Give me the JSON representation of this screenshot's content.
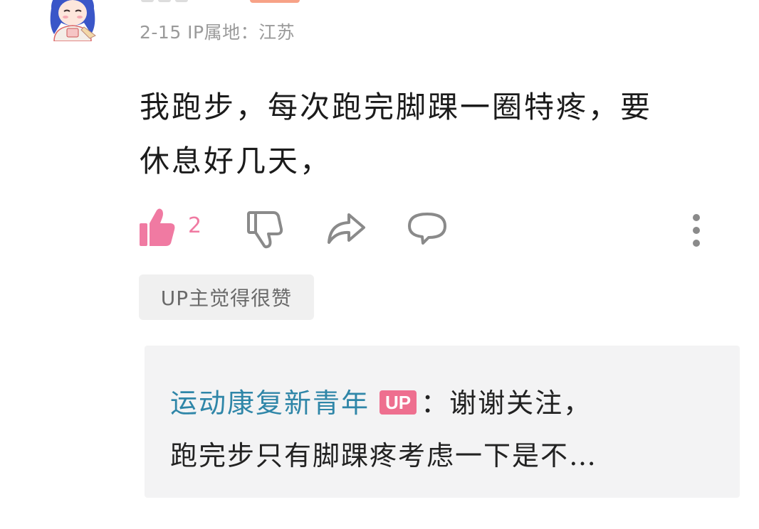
{
  "comment": {
    "meta": "2-15 IP属地：江苏",
    "content_line1": "我跑步，每次跑完脚踝一圈特疼，要",
    "content_line2": "休息好几天，",
    "like_count": "2"
  },
  "icons": {
    "like": "thumbs-up-icon",
    "dislike": "thumbs-down-icon",
    "share": "share-icon",
    "reply": "comment-bubble-icon",
    "more": "more-vertical-icon"
  },
  "colors": {
    "like_active": "#f07aa2",
    "up_badge": "#ee6f8f",
    "reply_author": "#2f86a8",
    "meta_gray": "#9a9a9a"
  },
  "up_like_tag": "UP主觉得很赞",
  "reply": {
    "author": "运动康复新青年",
    "badge": "UP",
    "separator": "：",
    "text_line1": "谢谢关注，",
    "text_line2": "跑完步只有脚踝疼考虑一下是不…"
  }
}
